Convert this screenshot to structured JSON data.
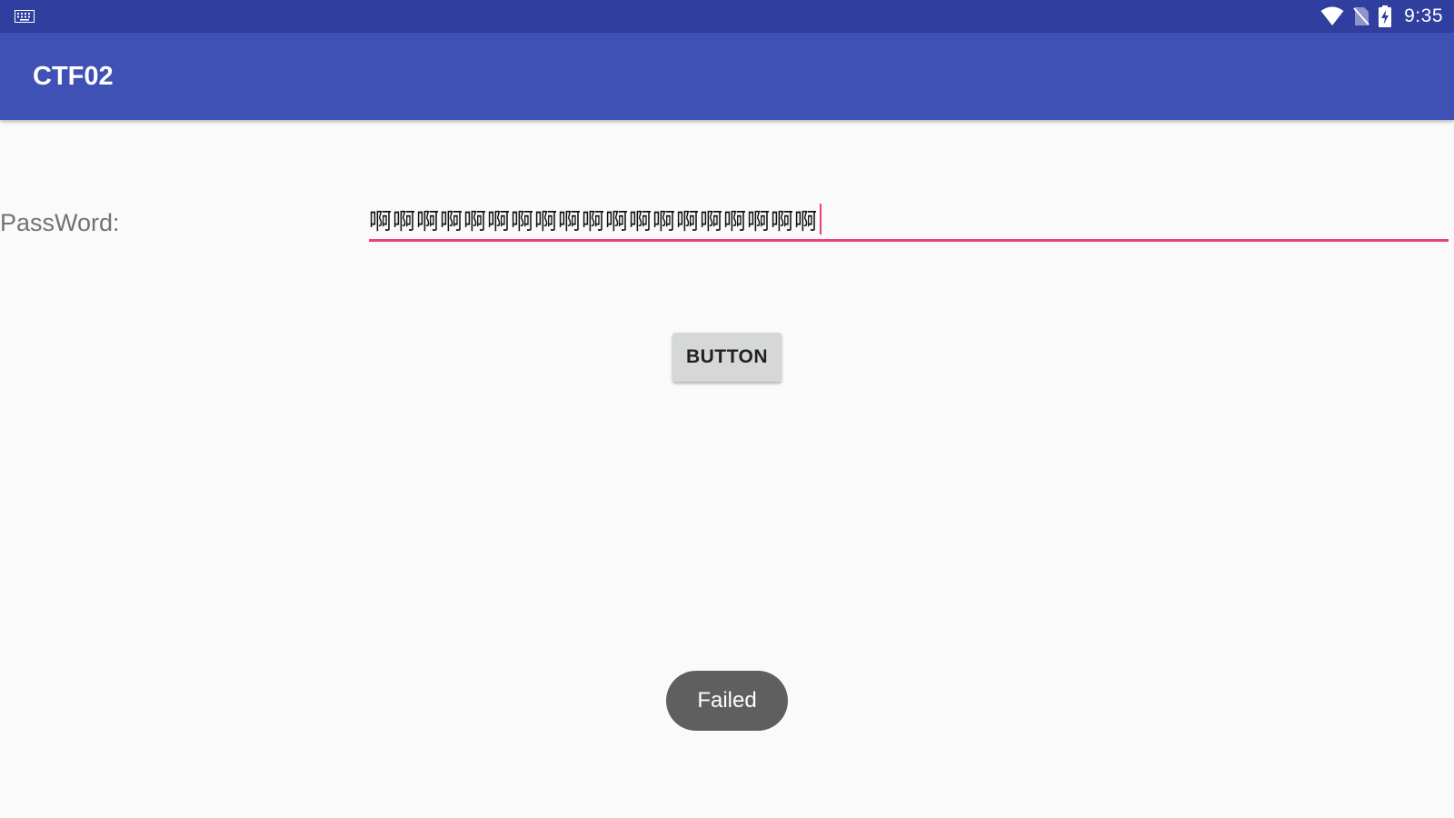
{
  "status_bar": {
    "time": "9:35",
    "icons": [
      "keyboard-icon",
      "wifi-icon",
      "no-sim-icon",
      "battery-charging-icon"
    ],
    "background": "#303f9f"
  },
  "app_bar": {
    "title": "CTF02",
    "background": "#3f51b5"
  },
  "form": {
    "password_label": "PassWord:",
    "password_value": "啊啊啊啊啊啊啊啊啊啊啊啊啊啊啊啊啊啊啊",
    "underline_color": "#ec407a"
  },
  "button": {
    "label": "BUTTON"
  },
  "toast": {
    "message": "Failed"
  }
}
